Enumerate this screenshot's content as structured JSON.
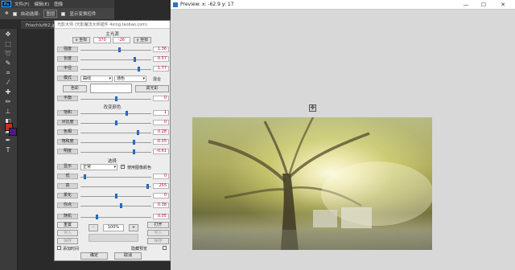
{
  "photoshop": {
    "logo": "Ps",
    "menu": [
      "文件(F)",
      "编辑(E)",
      "图像"
    ],
    "options": {
      "auto_select_label": "自动选择:",
      "auto_select_value": "图层",
      "show_transform_label": "显示变换控件"
    },
    "doc_tab": "Friechlufit2.jpg",
    "colors": {
      "foreground": "#d12b1a",
      "background": "#4a1b80"
    }
  },
  "dialog": {
    "title": "光影大师 (光影魔法大师插件 4xing.taobao.com)",
    "main_light": {
      "heading": "主光源",
      "x_label": "x 坐标",
      "x_value": "370",
      "y_value": "-26",
      "y_label": "y 坐标",
      "rows": [
        {
          "label": "强度",
          "value": "1.36",
          "fraction": 0.55
        },
        {
          "label": "长度",
          "value": "0.57",
          "fraction": 0.78
        },
        {
          "label": "半径",
          "value": "1.77",
          "fraction": 0.83
        }
      ]
    },
    "mode": {
      "label": "模式",
      "value": "曲线",
      "color_select": "通色",
      "blend_label": "混合"
    },
    "color_row": {
      "color_label": "色彩",
      "highlight_label": "高光彩"
    },
    "balance": {
      "label": "平衡",
      "value": "0",
      "fraction": 0.5
    },
    "change_color": {
      "heading": "改变颜色",
      "rows": [
        {
          "label": "饱和",
          "value": "1",
          "fraction": 0.66
        },
        {
          "label": "对比度",
          "value": "0",
          "fraction": 0.5
        },
        {
          "label": "色相",
          "value": "0.28",
          "fraction": 0.82
        },
        {
          "label": "饱和度",
          "value": "-0.05",
          "fraction": 0.77
        },
        {
          "label": "明度",
          "value": "-0.61",
          "fraction": 0.76
        }
      ]
    },
    "selection": {
      "heading": "选择",
      "show_label": "显示",
      "show_value": "正常",
      "use_image_color_label": "使用图像颜色",
      "use_image_color_checked": true,
      "rows": [
        {
          "label": "低",
          "value": "0",
          "fraction": 0.05
        },
        {
          "label": "高",
          "value": "255",
          "fraction": 0.97
        },
        {
          "label": "柔化",
          "value": "0",
          "fraction": 0.5
        },
        {
          "label": "你点",
          "value": "0.38",
          "fraction": 0.58
        }
      ]
    },
    "random": {
      "label": "随机",
      "value": "0.05",
      "fraction": 0.22
    },
    "bottom": {
      "reset_label": "重置",
      "import_label": "导入",
      "open_label": "打开",
      "save_label": "保存",
      "minus_label": "-",
      "plus_label": "+",
      "zoom": "100%",
      "add_time_label": "添加时间",
      "hide_preview_label": "隐藏预览",
      "ok_label": "确定",
      "cancel_label": "取消"
    }
  },
  "preview": {
    "title": "Preview:  x: -62.9  y: 17",
    "minimize": "—",
    "maximize": "☐",
    "close": "✕"
  }
}
